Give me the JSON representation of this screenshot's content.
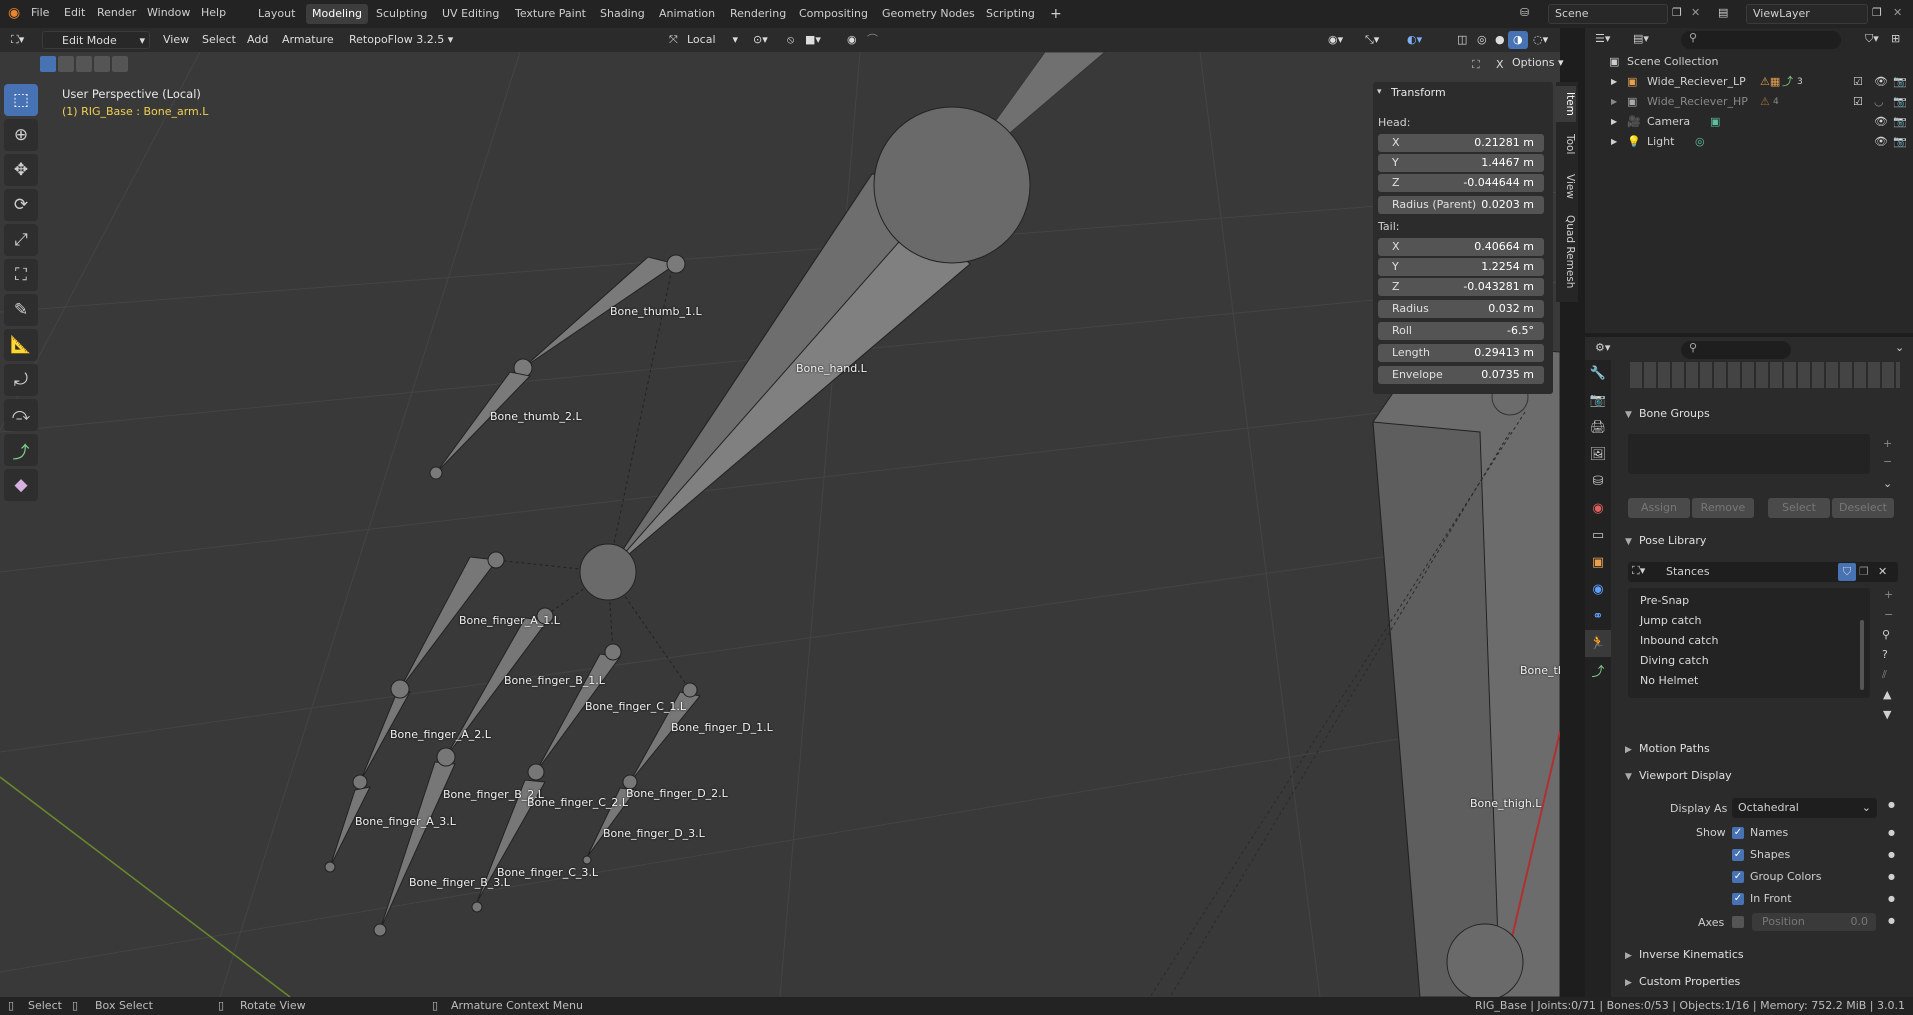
{
  "topbar": {
    "menus": [
      "File",
      "Edit",
      "Render",
      "Window",
      "Help"
    ],
    "workspaces": [
      "Layout",
      "Modeling",
      "Sculpting",
      "UV Editing",
      "Texture Paint",
      "Shading",
      "Animation",
      "Rendering",
      "Compositing",
      "Geometry Nodes",
      "Scripting"
    ],
    "active_workspace": "Modeling",
    "add_tab": "+",
    "scene": "Scene",
    "view_layer": "ViewLayer"
  },
  "viewport_header": {
    "mode": "Edit Mode",
    "menus": [
      "View",
      "Select",
      "Add",
      "Armature"
    ],
    "addon": "RetopoFlow 3.2.5",
    "orientation": "Local",
    "options": "Options",
    "close_x": "X"
  },
  "viewport": {
    "perspective": "User Perspective (Local)",
    "active": "(1) RIG_Base : Bone_arm.L",
    "bones": {
      "thumb1": "Bone_thumb_1.L",
      "thumb2": "Bone_thumb_2.L",
      "hand": "Bone_hand.L",
      "fa1": "Bone_finger_A_1.L",
      "fa2": "Bone_finger_A_2.L",
      "fa3": "Bone_finger_A_3.L",
      "fb1": "Bone_finger_B_1.L",
      "fb2": "Bone_finger_B_2.L",
      "fb3": "Bone_finger_B_3.L",
      "fc1": "Bone_finger_C_1.L",
      "fc2": "Bone_finger_C_2.L",
      "fc3": "Bone_finger_C_3.L",
      "fd1": "Bone_finger_D_1.L",
      "fd2": "Bone_finger_D_2.L",
      "fd3": "Bone_finger_D_3.L",
      "thigh": "Bone_thigh.L",
      "cut": "Bone_th"
    }
  },
  "transform": {
    "title": "Transform",
    "head_label": "Head:",
    "head": [
      {
        "l": "X",
        "v": "0.21281 m"
      },
      {
        "l": "Y",
        "v": "1.4467 m"
      },
      {
        "l": "Z",
        "v": "-0.044644 m"
      }
    ],
    "radius_parent": {
      "l": "Radius (Parent)",
      "v": "0.0203 m"
    },
    "tail_label": "Tail:",
    "tail": [
      {
        "l": "X",
        "v": "0.40664 m"
      },
      {
        "l": "Y",
        "v": "1.2254 m"
      },
      {
        "l": "Z",
        "v": "-0.043281 m"
      }
    ],
    "extra": [
      {
        "l": "Radius",
        "v": "0.032 m"
      },
      {
        "l": "Roll",
        "v": "-6.5°"
      },
      {
        "l": "Length",
        "v": "0.29413 m"
      },
      {
        "l": "Envelope",
        "v": "0.0735 m"
      }
    ]
  },
  "npanel_tabs": [
    "Item",
    "Tool",
    "View",
    "Quad Remesh"
  ],
  "outliner": {
    "root": "Scene Collection",
    "items": [
      {
        "name": "Wide_Reciever_LP",
        "badge": "3"
      },
      {
        "name": "Wide_Reciever_HP",
        "badge": "4"
      },
      {
        "name": "Camera",
        "badge": ""
      },
      {
        "name": "Light",
        "badge": ""
      }
    ]
  },
  "properties": {
    "bone_groups": "Bone Groups",
    "bg_buttons": [
      "Assign",
      "Remove",
      "Select",
      "Deselect"
    ],
    "pose_library": "Pose Library",
    "pose_lib_name": "Stances",
    "poses": [
      "Pre-Snap",
      "Jump catch",
      "Inbound catch",
      "Diving catch",
      "No Helmet"
    ],
    "motion_paths": "Motion Paths",
    "viewport_display": "Viewport Display",
    "display_as_label": "Display As",
    "display_as_value": "Octahedral",
    "show_label": "Show",
    "show_options": [
      "Names",
      "Shapes",
      "Group Colors",
      "In Front"
    ],
    "axes_label": "Axes",
    "position_label": "Position",
    "position_value": "0.0",
    "inverse_kinematics": "Inverse Kinematics",
    "custom_properties": "Custom Properties"
  },
  "statusbar": {
    "select": "Select",
    "box_select": "Box Select",
    "rotate_view": "Rotate View",
    "context_menu": "Armature Context Menu",
    "stats": "RIG_Base | Joints:0/71 | Bones:0/53 | Objects:1/16 | Memory: 752.2 MiB | 3.0.1"
  },
  "colors": {
    "accent": "#4772b3",
    "active_text": "#f0d050",
    "grid_x": "#6a8a2a"
  }
}
